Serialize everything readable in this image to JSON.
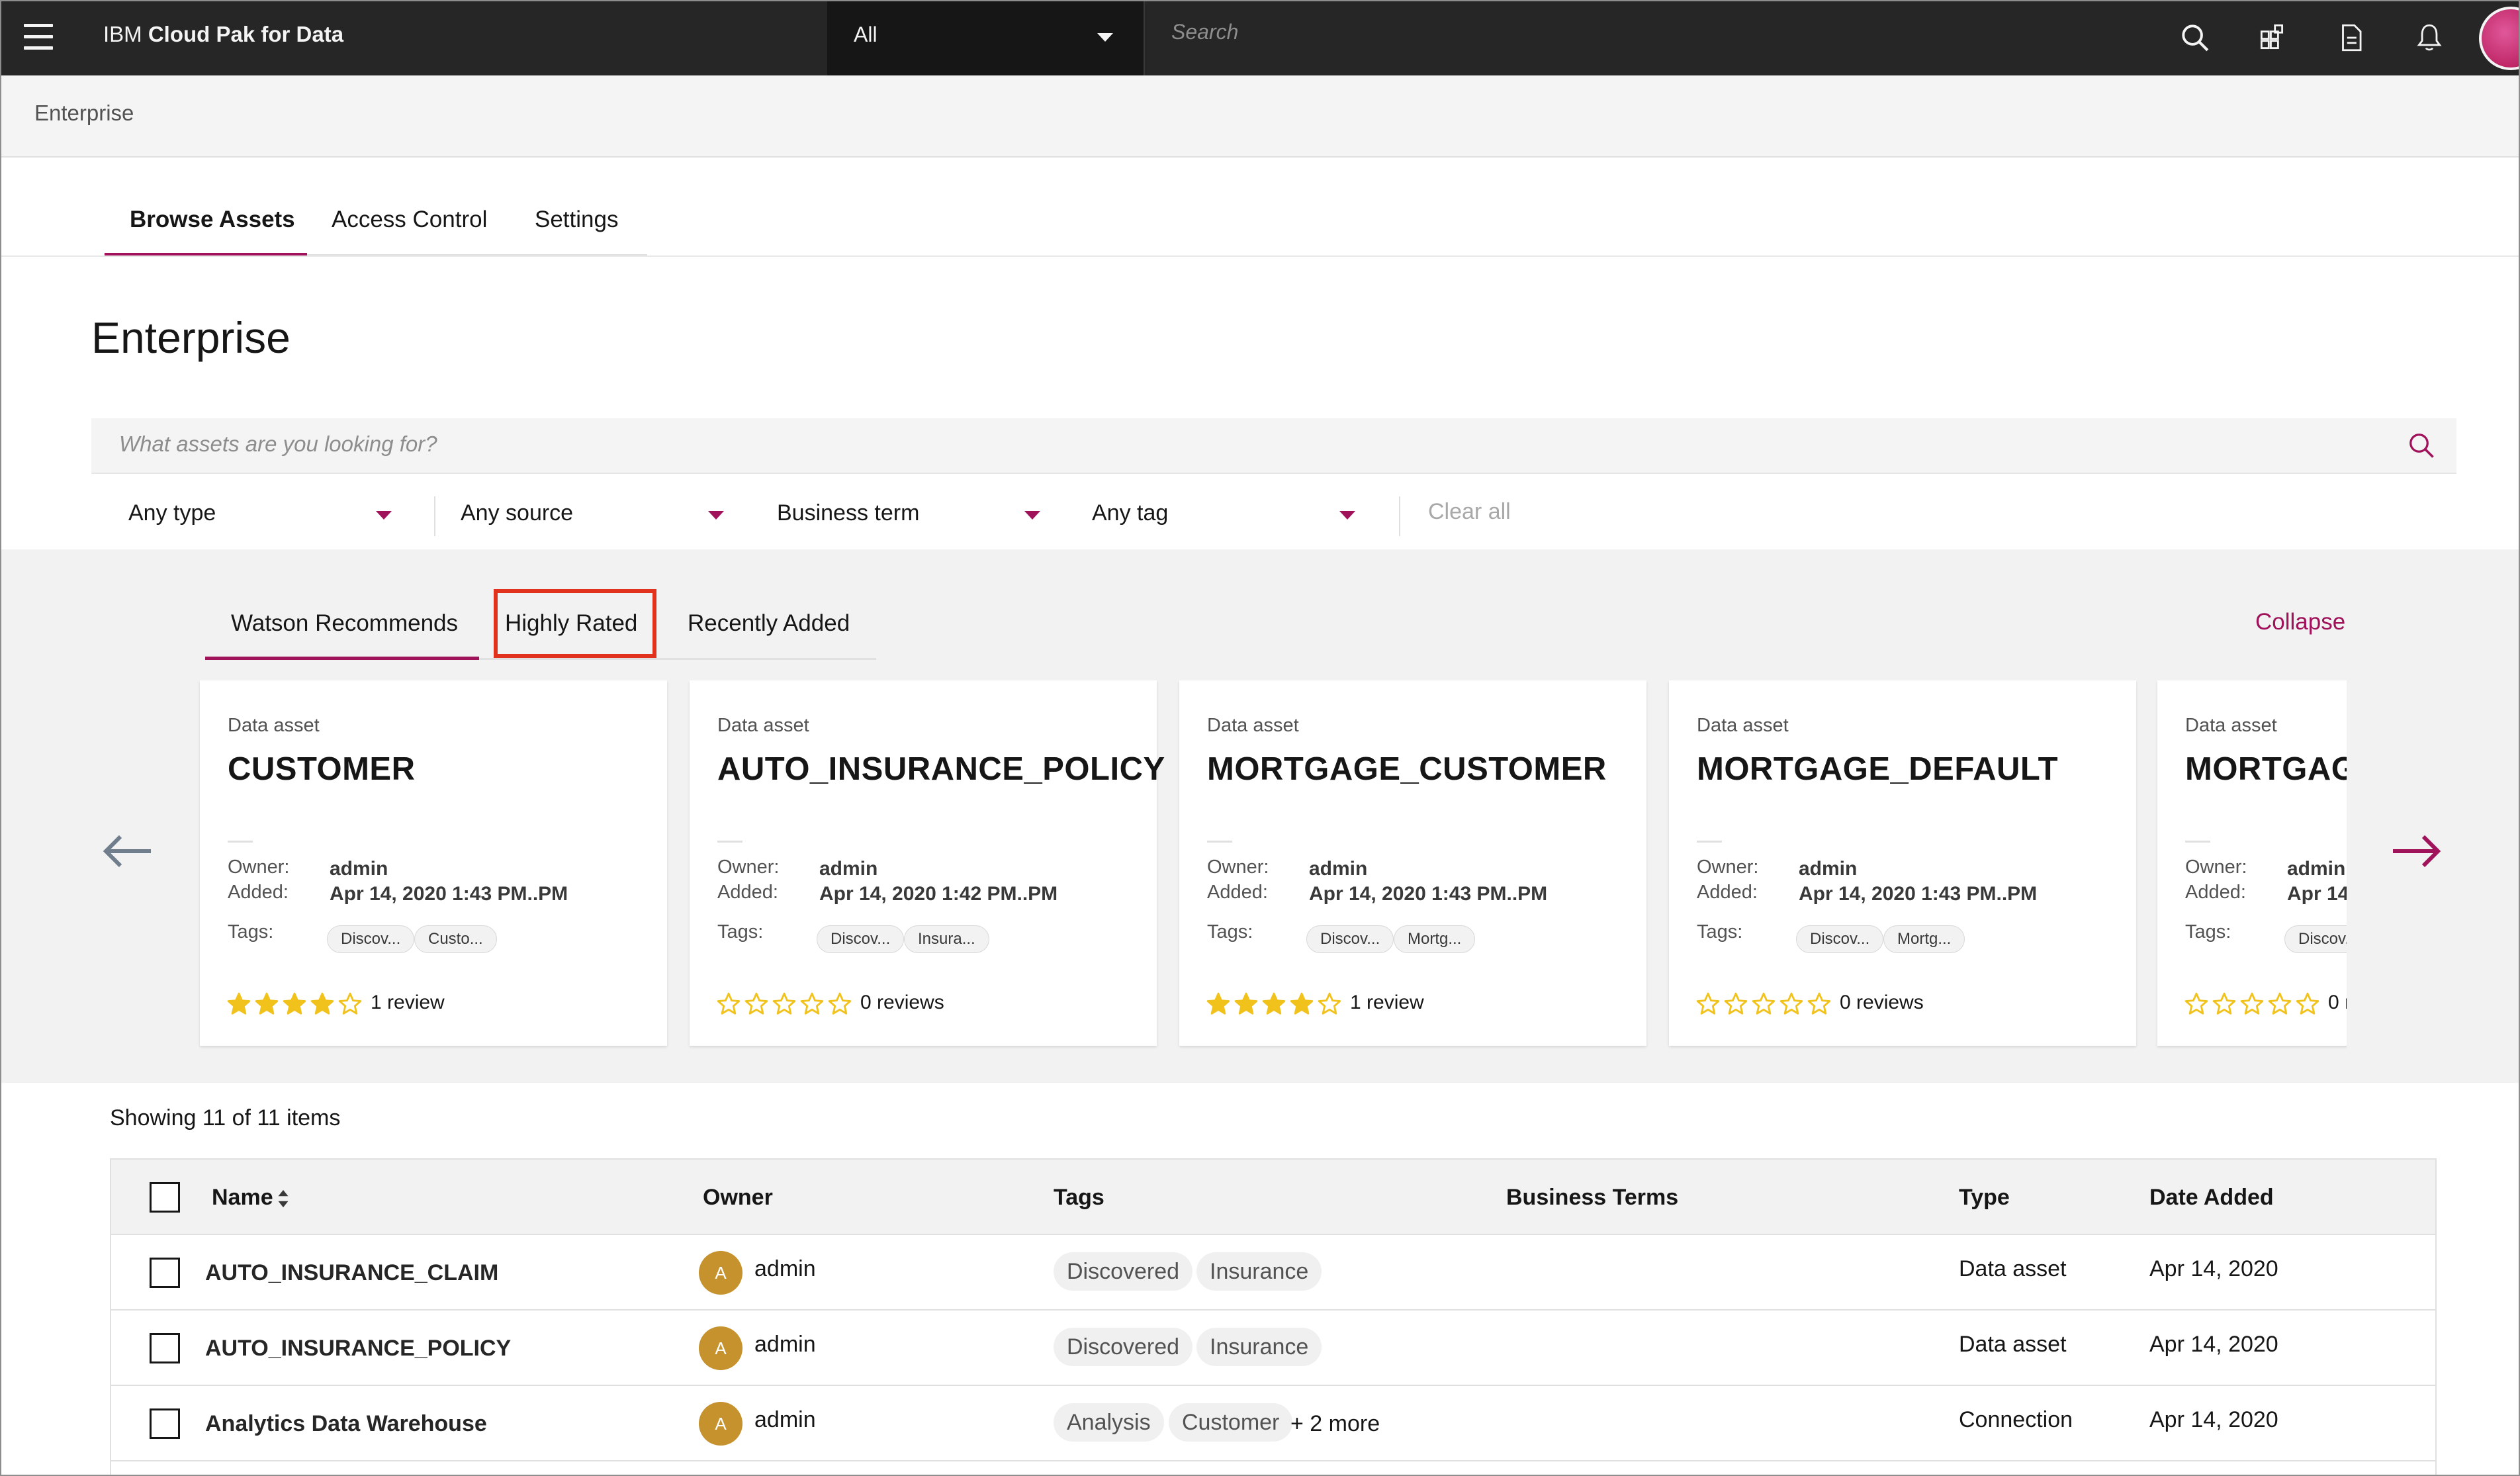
{
  "topbar": {
    "brand_ibm": "IBM",
    "brand_product": "Cloud Pak for Data",
    "scope_value": "All",
    "search_placeholder": "Search",
    "icons": [
      "menu-icon",
      "search-icon",
      "apps-icon",
      "document-icon",
      "notification-icon",
      "user-avatar"
    ]
  },
  "breadcrumb": {
    "label": "Enterprise"
  },
  "page_tabs": [
    {
      "label": "Browse Assets",
      "active": true
    },
    {
      "label": "Access Control",
      "active": false
    },
    {
      "label": "Settings",
      "active": false
    }
  ],
  "page_title": "Enterprise",
  "asset_search": {
    "placeholder": "What assets are you looking for?"
  },
  "filters": [
    {
      "label": "Any type"
    },
    {
      "label": "Any source"
    },
    {
      "label": "Business term"
    },
    {
      "label": "Any tag"
    }
  ],
  "clear_all": "Clear all",
  "recommend": {
    "tabs": [
      {
        "label": "Watson Recommends",
        "active": true
      },
      {
        "label": "Highly Rated",
        "highlighted": true
      },
      {
        "label": "Recently Added"
      }
    ],
    "collapse": "Collapse",
    "owner_key": "Owner:",
    "added_key": "Added:",
    "tags_key": "Tags:",
    "cards": [
      {
        "kind": "Data asset",
        "title": "CUSTOMER",
        "owner": "admin",
        "added": "Apr 14, 2020 1:43 PM..PM",
        "tags": [
          "Discov...",
          "Custo..."
        ],
        "rating": 4,
        "reviews": "1 review"
      },
      {
        "kind": "Data asset",
        "title": "AUTO_INSURANCE_POLICY",
        "owner": "admin",
        "added": "Apr 14, 2020 1:42 PM..PM",
        "tags": [
          "Discov...",
          "Insura..."
        ],
        "rating": 0,
        "reviews": "0 reviews"
      },
      {
        "kind": "Data asset",
        "title": "MORTGAGE_CUSTOMER",
        "owner": "admin",
        "added": "Apr 14, 2020 1:43 PM..PM",
        "tags": [
          "Discov...",
          "Mortg..."
        ],
        "rating": 4,
        "reviews": "1 review"
      },
      {
        "kind": "Data asset",
        "title": "MORTGAGE_DEFAULT",
        "owner": "admin",
        "added": "Apr 14, 2020 1:43 PM..PM",
        "tags": [
          "Discov...",
          "Mortg..."
        ],
        "rating": 0,
        "reviews": "0 reviews"
      },
      {
        "kind": "Data asset",
        "title": "MORTGAGE",
        "owner": "admin",
        "added": "Apr 14",
        "tags": [
          "Discov..."
        ],
        "rating": 0,
        "reviews": "0 r"
      }
    ],
    "star_color": "#f1c21b"
  },
  "showing": "Showing 11 of 11 items",
  "table": {
    "headers": {
      "name": "Name",
      "owner": "Owner",
      "tags": "Tags",
      "business_terms": "Business Terms",
      "type": "Type",
      "date_added": "Date Added"
    },
    "rows": [
      {
        "name": "AUTO_INSURANCE_CLAIM",
        "owner_initial": "A",
        "owner": "admin",
        "tags": [
          "Discovered",
          "Insurance"
        ],
        "more": "",
        "type": "Data asset",
        "date": "Apr 14, 2020"
      },
      {
        "name": "AUTO_INSURANCE_POLICY",
        "owner_initial": "A",
        "owner": "admin",
        "tags": [
          "Discovered",
          "Insurance"
        ],
        "more": "",
        "type": "Data asset",
        "date": "Apr 14, 2020"
      },
      {
        "name": "Analytics Data Warehouse",
        "owner_initial": "A",
        "owner": "admin",
        "tags": [
          "Analysis",
          "Customer"
        ],
        "more": "+ 2 more",
        "type": "Connection",
        "date": "Apr 14, 2020"
      }
    ]
  },
  "colors": {
    "accent": "#a0135b",
    "highlight_box": "#e0321d",
    "topbar": "#262626",
    "avatar": "#c6922d"
  }
}
